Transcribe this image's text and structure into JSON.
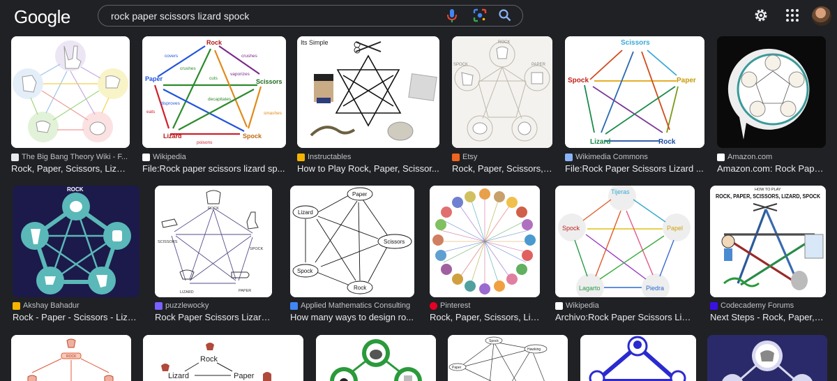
{
  "header": {
    "logo": "Google",
    "search_query": "rock paper scissors lizard spock"
  },
  "row1": [
    {
      "source": "The Big Bang Theory Wiki - F...",
      "title": "Rock, Paper, Scissors, Lizar...",
      "fav_color": "#e8eaed"
    },
    {
      "source": "Wikipedia",
      "title": "File:Rock paper scissors lizard sp...",
      "fav_color": "#ffffff"
    },
    {
      "source": "Instructables",
      "title": "How to Play Rock, Paper, Scissor...",
      "fav_color": "#f5b400"
    },
    {
      "source": "Etsy",
      "title": "Rock, Paper, Scissors, ...",
      "fav_color": "#f1641e"
    },
    {
      "source": "Wikimedia Commons",
      "title": "File:Rock Paper Scissors Lizard ...",
      "fav_color": "#8ab4f8"
    },
    {
      "source": "Amazon.com",
      "title": "Amazon.com: Rock Pape...",
      "fav_color": "#ffffff"
    }
  ],
  "row2": [
    {
      "source": "Akshay Bahadur",
      "title": "Rock - Paper - Scissors - Lizar...",
      "fav_color": "#f5b400"
    },
    {
      "source": "puzzlewocky",
      "title": "Rock Paper Scissors Lizard ...",
      "fav_color": "#7b61ff"
    },
    {
      "source": "Applied Mathematics Consulting",
      "title": "How many ways to design ro...",
      "fav_color": "#4285f4"
    },
    {
      "source": "Pinterest",
      "title": "Rock, Paper, Scissors, Liz...",
      "fav_color": "#e60023"
    },
    {
      "source": "Wikipedia",
      "title": "Archivo:Rock Paper Scissors Liza...",
      "fav_color": "#ffffff"
    },
    {
      "source": "Codecademy Forums",
      "title": "Next Steps - Rock, Paper, S...",
      "fav_color": "#3a10e5"
    }
  ],
  "labels": {
    "rock": "Rock",
    "paper": "Paper",
    "scissors": "Scissors",
    "lizard": "Lizard",
    "spock": "Spock",
    "its_simple": "Its Simple",
    "wiki_edges": [
      "covers",
      "crushes",
      "crushes",
      "vaporizes",
      "cuts",
      "decapitates",
      "disproves",
      "eats",
      "smashes",
      "poisons"
    ],
    "es": {
      "tijeras": "Tijeras",
      "papel": "Papel",
      "spock": "Spock",
      "lagarto": "Lagarto",
      "piedra": "Piedra"
    },
    "caps": {
      "rock": "ROCK",
      "spock": "SPOCK",
      "paper": "PAPER",
      "lizard": "LIZARD",
      "scissors": "SCISSORS"
    },
    "hawking": "Hawking",
    "howto": "HOW TO PLAY",
    "banner": "ROCK, PAPER, SCISSORS, LIZARD, SPOCK"
  }
}
